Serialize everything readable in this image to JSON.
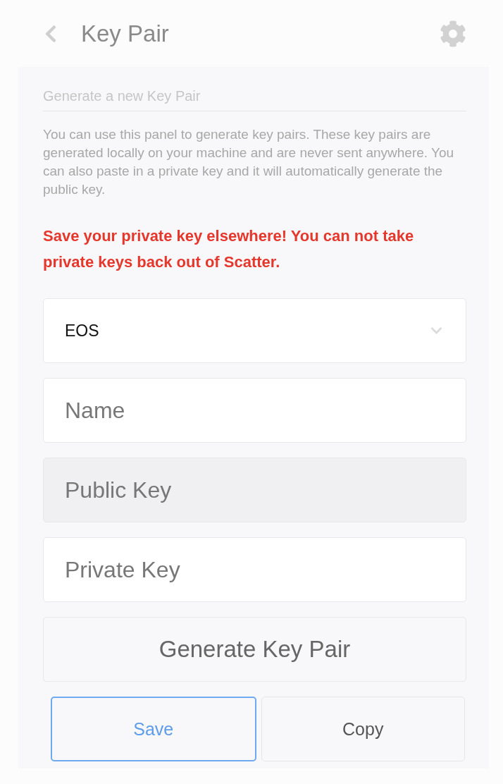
{
  "header": {
    "title": "Key Pair"
  },
  "section": {
    "title": "Generate a new Key Pair",
    "description": "You can use this panel to generate key pairs. These key pairs are generated locally on your machine and are never sent anywhere. You can also paste in a private key and it will automatically generate the public key.",
    "warning": "Save your private key elsewhere! You can not take private keys back out of Scatter."
  },
  "network_select": {
    "value": "EOS"
  },
  "fields": [
    {
      "placeholder": "Name",
      "disabled": false
    },
    {
      "placeholder": "Public Key",
      "disabled": true
    },
    {
      "placeholder": "Private Key",
      "disabled": false
    }
  ],
  "generate_button": {
    "label": "Generate Key Pair"
  },
  "actions": [
    {
      "label": "Save",
      "focused": true
    },
    {
      "label": "Copy",
      "focused": false
    }
  ]
}
